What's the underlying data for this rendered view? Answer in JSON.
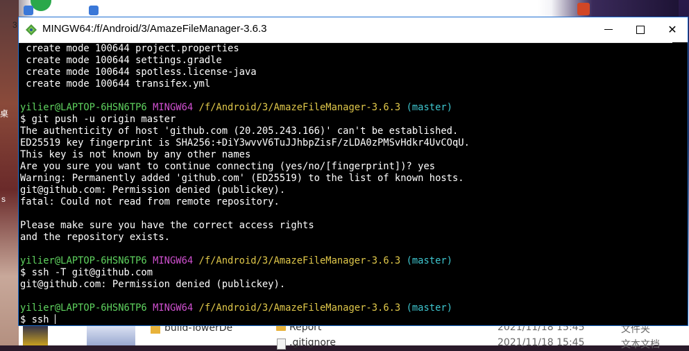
{
  "desktop": {
    "left_labels": [
      "3",
      "桌",
      "s"
    ],
    "left_strip_label": "build-TowerDe"
  },
  "explorer": {
    "rows": [
      {
        "name": "Report",
        "date": "2021/11/18 15:45",
        "type": "文件夹"
      },
      {
        "name": ".gitignore",
        "date": "2021/11/18 15:45",
        "type": "文本文档"
      }
    ]
  },
  "window": {
    "title": "MINGW64:/f/Android/3/AmazeFileManager-3.6.3",
    "minimize_label": "",
    "maximize_label": "",
    "close_label": "✕"
  },
  "terminal": {
    "lines": [
      {
        "segments": [
          {
            "text": " create mode 100644 project.properties",
            "color": "white"
          }
        ]
      },
      {
        "segments": [
          {
            "text": " create mode 100644 settings.gradle",
            "color": "white"
          }
        ]
      },
      {
        "segments": [
          {
            "text": " create mode 100644 spotless.license-java",
            "color": "white"
          }
        ]
      },
      {
        "segments": [
          {
            "text": " create mode 100644 transifex.yml",
            "color": "white"
          }
        ]
      },
      {
        "segments": [
          {
            "text": "",
            "color": "white"
          }
        ]
      },
      {
        "segments": [
          {
            "text": "yilier@LAPTOP-6HSN6TP6 ",
            "color": "green"
          },
          {
            "text": "MINGW64 ",
            "color": "magenta"
          },
          {
            "text": "/f/Android/3/AmazeFileManager-3.6.3 ",
            "color": "yellow"
          },
          {
            "text": "(master)",
            "color": "cyan"
          }
        ]
      },
      {
        "segments": [
          {
            "text": "$ git push -u origin master",
            "color": "white"
          }
        ]
      },
      {
        "segments": [
          {
            "text": "The authenticity of host 'github.com (20.205.243.166)' can't be established.",
            "color": "white"
          }
        ]
      },
      {
        "segments": [
          {
            "text": "ED25519 key fingerprint is SHA256:+DiY3wvvV6TuJJhbpZisF/zLDA0zPMSvHdkr4UvCOqU.",
            "color": "white"
          }
        ]
      },
      {
        "segments": [
          {
            "text": "This key is not known by any other names",
            "color": "white"
          }
        ]
      },
      {
        "segments": [
          {
            "text": "Are you sure you want to continue connecting (yes/no/[fingerprint])? yes",
            "color": "white"
          }
        ]
      },
      {
        "segments": [
          {
            "text": "Warning: Permanently added 'github.com' (ED25519) to the list of known hosts.",
            "color": "white"
          }
        ]
      },
      {
        "segments": [
          {
            "text": "git@github.com: Permission denied (publickey).",
            "color": "white"
          }
        ]
      },
      {
        "segments": [
          {
            "text": "fatal: Could not read from remote repository.",
            "color": "white"
          }
        ]
      },
      {
        "segments": [
          {
            "text": "",
            "color": "white"
          }
        ]
      },
      {
        "segments": [
          {
            "text": "Please make sure you have the correct access rights",
            "color": "white"
          }
        ]
      },
      {
        "segments": [
          {
            "text": "and the repository exists.",
            "color": "white"
          }
        ]
      },
      {
        "segments": [
          {
            "text": "",
            "color": "white"
          }
        ]
      },
      {
        "segments": [
          {
            "text": "yilier@LAPTOP-6HSN6TP6 ",
            "color": "green"
          },
          {
            "text": "MINGW64 ",
            "color": "magenta"
          },
          {
            "text": "/f/Android/3/AmazeFileManager-3.6.3 ",
            "color": "yellow"
          },
          {
            "text": "(master)",
            "color": "cyan"
          }
        ]
      },
      {
        "segments": [
          {
            "text": "$ ssh -T git@github.com",
            "color": "white"
          }
        ]
      },
      {
        "segments": [
          {
            "text": "git@github.com: Permission denied (publickey).",
            "color": "white"
          }
        ]
      },
      {
        "segments": [
          {
            "text": "",
            "color": "white"
          }
        ]
      },
      {
        "segments": [
          {
            "text": "yilier@LAPTOP-6HSN6TP6 ",
            "color": "green"
          },
          {
            "text": "MINGW64 ",
            "color": "magenta"
          },
          {
            "text": "/f/Android/3/AmazeFileManager-3.6.3 ",
            "color": "yellow"
          },
          {
            "text": "(master)",
            "color": "cyan"
          }
        ]
      }
    ],
    "input_prompt": "$ ",
    "input_value": "ssh "
  },
  "colors": {
    "user_host": "#5fd35f",
    "env": "#d050d0",
    "path": "#e0c84a",
    "branch": "#3ec6cf",
    "window_border": "#1f6fd1"
  },
  "icons": {
    "app": "git-bash-icon",
    "minimize": "minimize-icon",
    "maximize": "maximize-icon",
    "close": "close-icon"
  }
}
